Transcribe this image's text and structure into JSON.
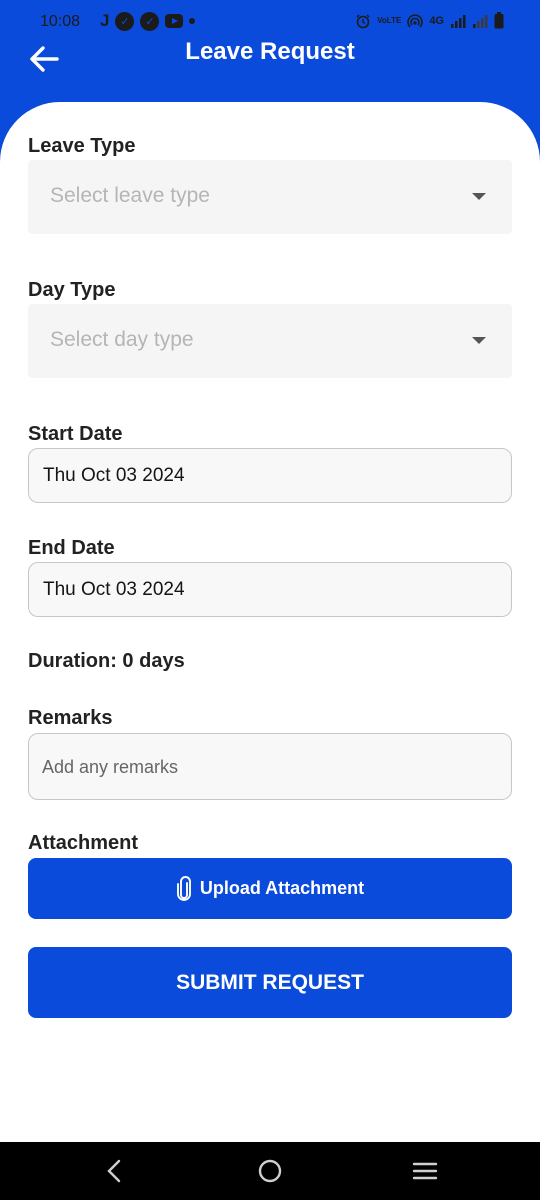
{
  "status_bar": {
    "time": "10:08",
    "left_icons": [
      "j-letter",
      "app-icon",
      "app-icon",
      "youtube-icon",
      "notification-dot"
    ],
    "network": "4G",
    "volte": "VoLTE"
  },
  "header": {
    "title": "Leave Request",
    "back_icon": "arrow-left-icon",
    "background_color": "#0a4bdb"
  },
  "form": {
    "leave_type": {
      "label": "Leave Type",
      "placeholder": "Select leave type"
    },
    "day_type": {
      "label": "Day Type",
      "placeholder": "Select day type"
    },
    "start_date": {
      "label": "Start Date",
      "value": "Thu Oct 03 2024"
    },
    "end_date": {
      "label": "End Date",
      "value": "Thu Oct 03 2024"
    },
    "duration": "Duration: 0 days",
    "remarks": {
      "label": "Remarks",
      "placeholder": "Add any remarks"
    },
    "attachment": {
      "label": "Attachment",
      "button_label": "Upload Attachment",
      "icon": "paperclip-icon"
    },
    "submit_label": "SUBMIT REQUEST"
  },
  "nav_bar": {
    "items": [
      "back-icon",
      "home-icon",
      "menu-icon"
    ]
  },
  "colors": {
    "accent": "#0a4bdb",
    "field_background": "#f5f5f5",
    "nav_background": "#000000"
  }
}
